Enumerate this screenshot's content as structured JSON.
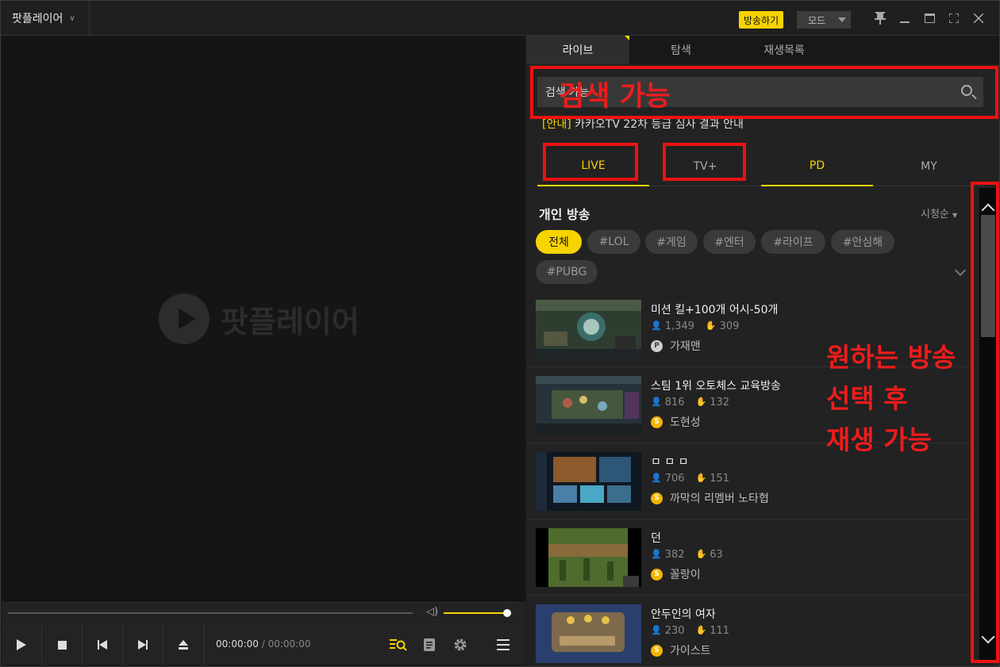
{
  "app": {
    "name": "팟플레이어",
    "broadcast_label": "방송하기",
    "mode_label": "모드"
  },
  "window_controls": [
    "pin-icon",
    "minimize-icon",
    "maximize-icon",
    "fullscreen-icon",
    "close-icon"
  ],
  "video": {
    "logo_text": "팟플레이어"
  },
  "player": {
    "time_current": "00:00:00",
    "time_separator": "/",
    "time_total": "00:00:00",
    "volume_level": 1.0,
    "controls": [
      "play-icon",
      "stop-icon",
      "prev-icon",
      "next-icon",
      "eject-icon"
    ],
    "right_controls": [
      "playlist-search-icon",
      "document-icon",
      "gear-icon",
      "menu-icon"
    ]
  },
  "panel": {
    "tabs": [
      "라이브",
      "탐색",
      "재생목록"
    ],
    "search": {
      "value": "검색 가능",
      "placeholder": ""
    },
    "notice": {
      "tag": "[안내]",
      "text": " 카카오TV 22차 등급 심사 결과 안내"
    },
    "subtabs": [
      "LIVE",
      "TV+",
      "PD",
      "MY"
    ],
    "section_title": "개인 방송",
    "sort_label": "시청순",
    "chips": [
      "전체",
      "#LOL",
      "#게임",
      "#엔터",
      "#라이프",
      "#안심해",
      "#PUBG"
    ],
    "streams": [
      {
        "title": "미션 킬+100개 어시-50개",
        "viewers": "1,349",
        "likes": "309",
        "author": "가재맨",
        "badge": "P",
        "badge_color": "#cfcfcf"
      },
      {
        "title": "스팀 1위 오토체스 교육방송",
        "viewers": "816",
        "likes": "132",
        "author": "도현성",
        "badge": "S",
        "badge_color": "#f5b400"
      },
      {
        "title": "ㅁ ㅁ ㅁ",
        "viewers": "706",
        "likes": "151",
        "author": "까막의 리멤버 노타협",
        "badge": "S",
        "badge_color": "#f5b400"
      },
      {
        "title": "던",
        "viewers": "382",
        "likes": "63",
        "author": "꼴랑이",
        "badge": "S",
        "badge_color": "#f5b400"
      },
      {
        "title": "안두인의 여자",
        "viewers": "230",
        "likes": "111",
        "author": "가이스트",
        "badge": "S",
        "badge_color": "#f5b400"
      }
    ]
  },
  "annotation": {
    "line1": "원하는 방송",
    "line2": "선택 후",
    "line3": "재생 가능",
    "color": "#ee1c1c"
  },
  "colors": {
    "accent": "#f7d300",
    "annotation": "#e11111"
  }
}
